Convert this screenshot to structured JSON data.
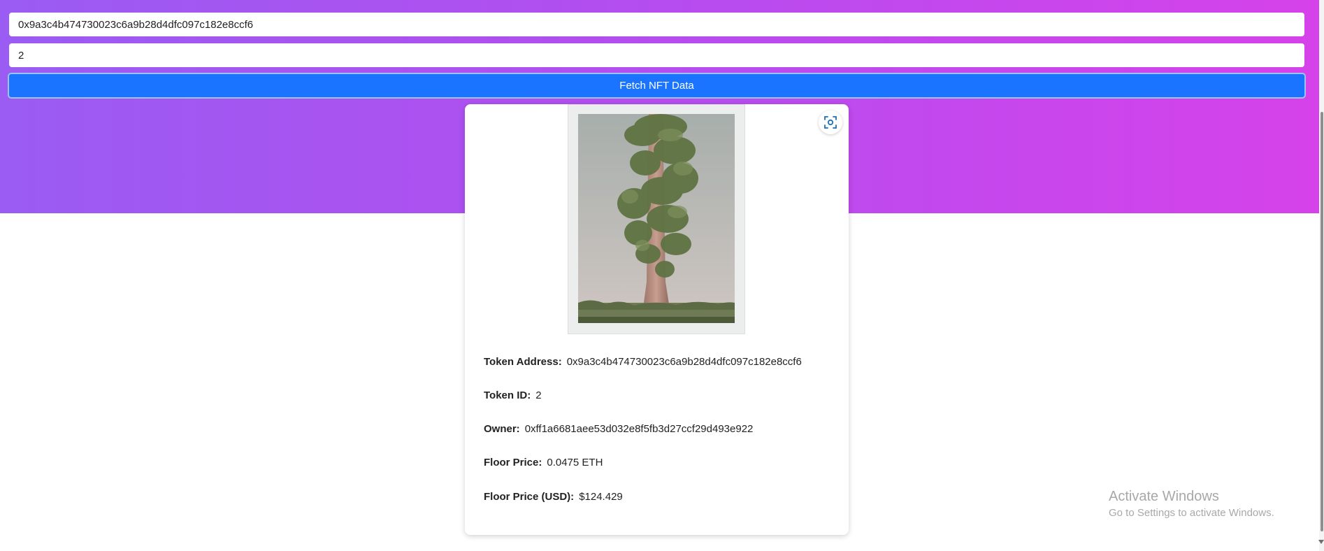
{
  "form": {
    "token_address_value": "0x9a3c4b474730023c6a9b28d4dfc097c182e8ccf6",
    "token_id_value": "2",
    "fetch_button_label": "Fetch NFT Data"
  },
  "nft_card": {
    "image_icon": "tree-artwork",
    "scan_icon": "scan-image-icon",
    "rows": [
      {
        "label": "Token Address:",
        "value": "0x9a3c4b474730023c6a9b28d4dfc097c182e8ccf6"
      },
      {
        "label": "Token ID:",
        "value": "2"
      },
      {
        "label": "Owner:",
        "value": "0xff1a6681aee53d032e8f5fb3d27ccf29d493e922"
      },
      {
        "label": "Floor Price:",
        "value": "0.0475 ETH"
      },
      {
        "label": "Floor Price (USD):",
        "value": "$124.429"
      }
    ]
  },
  "watermark": {
    "title": "Activate Windows",
    "subtitle": "Go to Settings to activate Windows."
  },
  "colors": {
    "gradient_start": "#9a5cf2",
    "gradient_end": "#d642ea",
    "button": "#1b74ff"
  }
}
